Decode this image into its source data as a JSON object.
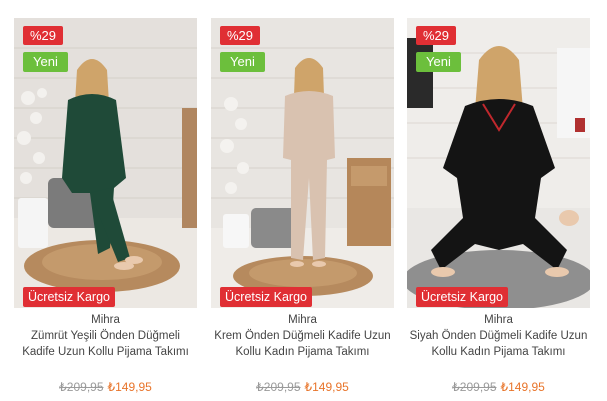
{
  "products": [
    {
      "discount": "%29",
      "new_badge": "Yeni",
      "shipping_badge": "Ücretsiz Kargo",
      "brand": "Mihra",
      "name": "Zümrüt Yeşili Önden Düğmeli Kadife Uzun Kollu Pijama Takımı",
      "old_price": "₺209,95",
      "price": "₺149,95",
      "garment_color": "#1f4a38"
    },
    {
      "discount": "%29",
      "new_badge": "Yeni",
      "shipping_badge": "Ücretsiz Kargo",
      "brand": "Mihra",
      "name": "Krem Önden Düğmeli Kadife Uzun Kollu Kadın Pijama Takımı",
      "old_price": "₺209,95",
      "price": "₺149,95",
      "garment_color": "#d9c2b0"
    },
    {
      "discount": "%29",
      "new_badge": "Yeni",
      "shipping_badge": "Ücretsiz Kargo",
      "brand": "Mihra",
      "name": "Siyah Önden Düğmeli Kadife Uzun Kollu Kadın Pijama Takımı",
      "old_price": "₺209,95",
      "price": "₺149,95",
      "garment_color": "#141414"
    }
  ],
  "colors": {
    "discount_badge": "#e02f34",
    "new_badge": "#6cbf3c",
    "sale_price": "#e8742a",
    "old_price": "#9a9a9a"
  }
}
